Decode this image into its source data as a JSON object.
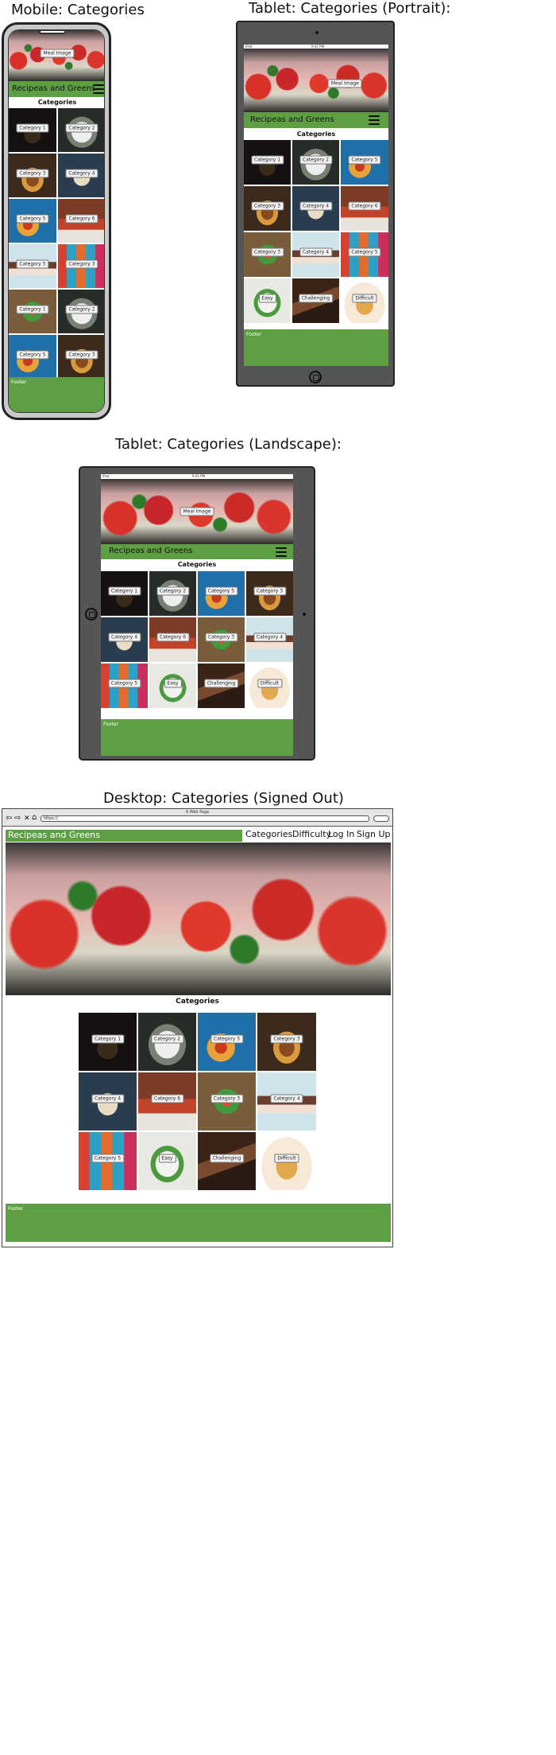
{
  "titles": {
    "mobile": "Mobile: Categories",
    "tablet_portrait": "Tablet: Categories (Portrait):",
    "tablet_landscape": "Tablet: Categories (Landscape):",
    "desktop": "Desktop: Categories (Signed Out)"
  },
  "site": {
    "brand": "Recipeas and Greens",
    "hero_label": "Meal Image",
    "section_heading": "Categories",
    "footer": "Footer"
  },
  "nav": {
    "categories": "Categories",
    "difficulty": "Difficulty",
    "login": "Log In",
    "signup": "Sign Up"
  },
  "browser": {
    "window_title": "A Web Page",
    "url": "https://"
  },
  "status": {
    "ipad": "iPad",
    "time": "9:41 PM"
  },
  "tiles": {
    "cat1": "Category 1",
    "cat2": "Category 2",
    "cat3": "Category 3",
    "cat4": "Category 4",
    "cat5": "Category 5",
    "cat6": "Category 6",
    "easy": "Easy",
    "challenging": "Challenging",
    "difficult": "Difficult"
  },
  "icons": [
    "menu-icon",
    "back-icon",
    "forward-icon",
    "stop-icon",
    "home-icon"
  ],
  "colors": {
    "brand_green": "#5f9f44",
    "device_gray": "#555555"
  }
}
